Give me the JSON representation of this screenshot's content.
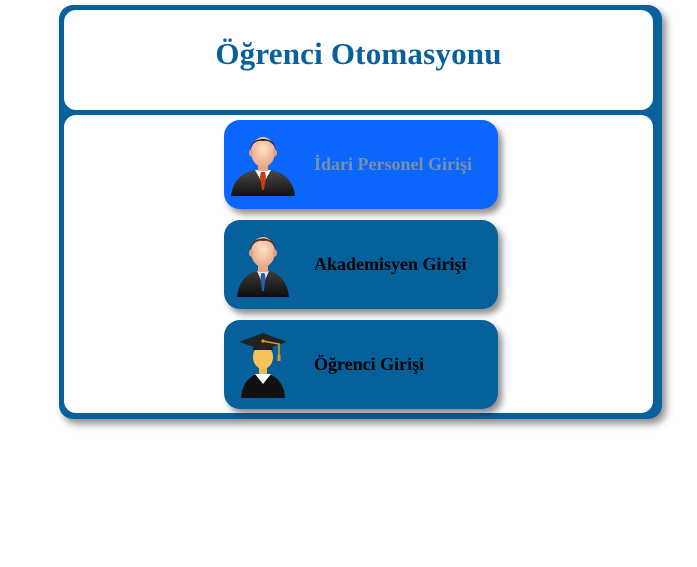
{
  "header": {
    "title": "Öğrenci Otomasyonu"
  },
  "menu": {
    "items": [
      {
        "label": "İdari Personel Girişi",
        "icon": "staff-avatar-icon",
        "state": "hover"
      },
      {
        "label": "Akademisyen Girişi",
        "icon": "academic-avatar-icon",
        "state": "default"
      },
      {
        "label": "Öğrenci Girişi",
        "icon": "student-graduate-icon",
        "state": "default"
      }
    ]
  },
  "colors": {
    "frame": "#08609c",
    "title": "#08609c",
    "button": "#05609c",
    "button_hover": "#0a66fc",
    "hover_text": "#7a8fa8"
  }
}
